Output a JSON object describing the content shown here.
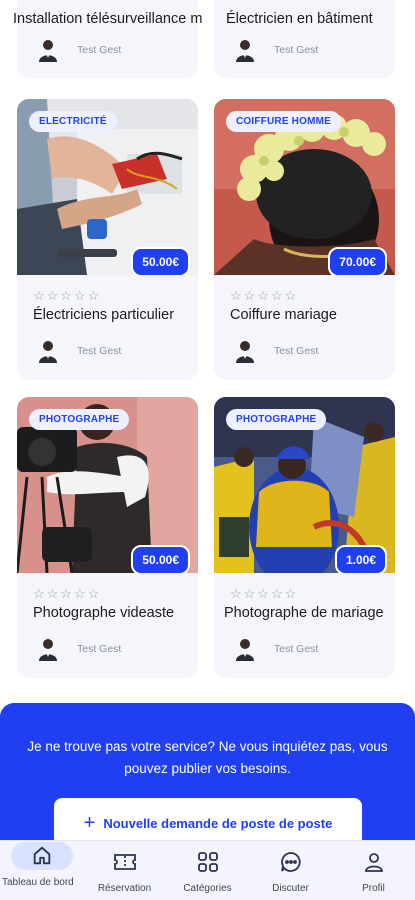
{
  "top_cards": [
    {
      "title": "Installation télésurveillance m",
      "author": "Test Gest"
    },
    {
      "title": "Électricien en bâtiment",
      "author": "Test Gest"
    }
  ],
  "cards": [
    {
      "category": "ELECTRICITÉ",
      "price": "50.00€",
      "rating": "☆☆☆☆☆",
      "title": "Électriciens particulier",
      "author": "Test Gest"
    },
    {
      "category": "COIFFURE HOMME",
      "price": "70.00€",
      "rating": "☆☆☆☆☆",
      "title": "Coiffure mariage",
      "author": "Test Gest"
    },
    {
      "category": "PHOTOGRAPHE",
      "price": "50.00€",
      "rating": "☆☆☆☆☆",
      "title": "Photographe videaste",
      "author": "Test Gest"
    },
    {
      "category": "PHOTOGRAPHE",
      "price": "1.00€",
      "rating": "☆☆☆☆☆",
      "title": "Photographe de mariage",
      "author": "Test Gest"
    }
  ],
  "cta": {
    "message": "Je ne trouve pas votre service? Ne vous inquiétez pas, vous pouvez publier vos besoins.",
    "button_label": "Nouvelle demande de poste de poste",
    "button_icon": "+"
  },
  "nav": {
    "items": [
      {
        "label": "Tableau de bord",
        "icon": "home-icon",
        "active": true
      },
      {
        "label": "Réservation",
        "icon": "ticket-icon"
      },
      {
        "label": "Catégories",
        "icon": "grid-icon"
      },
      {
        "label": "Discuter",
        "icon": "chat-icon"
      },
      {
        "label": "Profil",
        "icon": "person-icon"
      }
    ]
  },
  "colors": {
    "accent": "#1f3ff0",
    "badge_bg": "#eef0ff",
    "card_bg": "#f5f6fb",
    "nav_active": "#dbe2ff"
  }
}
